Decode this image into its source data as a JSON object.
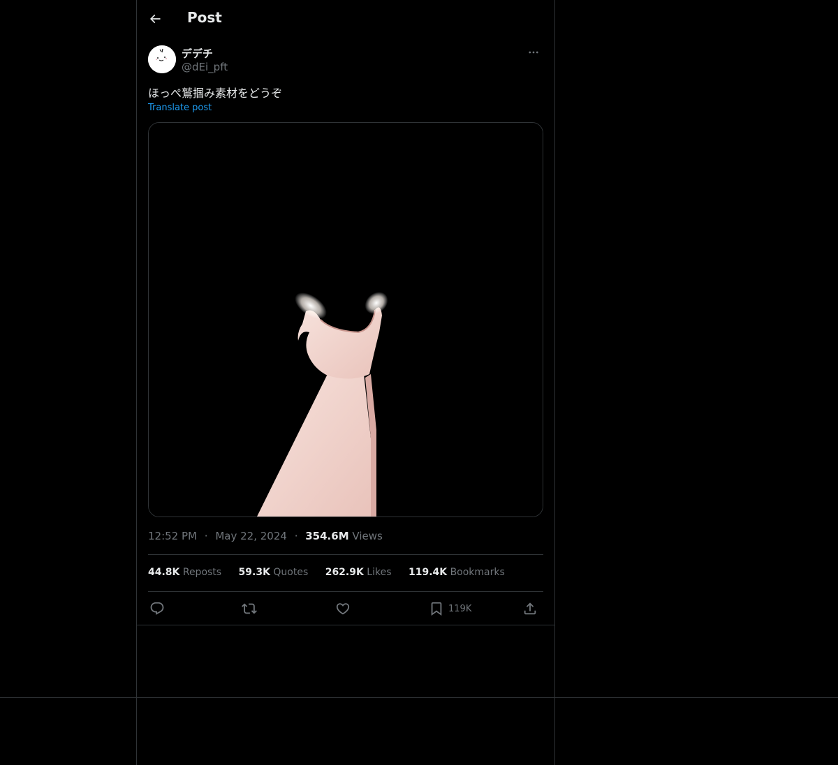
{
  "header": {
    "title": "Post",
    "back_icon": "arrow-left-icon"
  },
  "author": {
    "name": "デデチ",
    "handle": "@dEi_pft",
    "avatar_icon": "avatar-face-icon"
  },
  "post": {
    "text": "ほっぺ鷲掴み素材をどうぞ",
    "translate_label": "Translate post",
    "media_description_icon": "hand-pinch-image"
  },
  "meta": {
    "time": "12:52 PM",
    "date": "May 22, 2024",
    "views_count": "354.6M",
    "views_label": "Views",
    "separator": "·"
  },
  "stats": {
    "reposts_count": "44.8K",
    "reposts_label": "Reposts",
    "quotes_count": "59.3K",
    "quotes_label": "Quotes",
    "likes_count": "262.9K",
    "likes_label": "Likes",
    "bookmarks_count": "119.4K",
    "bookmarks_label": "Bookmarks"
  },
  "actions": {
    "reply_icon": "reply-icon",
    "repost_icon": "repost-icon",
    "like_icon": "heart-icon",
    "bookmark_icon": "bookmark-icon",
    "bookmark_count": "119K",
    "share_icon": "share-icon"
  },
  "colors": {
    "background": "#000000",
    "text_primary": "#e7e9ea",
    "text_secondary": "#71767b",
    "link_blue": "#1d9bf0",
    "border": "#2f3336"
  }
}
